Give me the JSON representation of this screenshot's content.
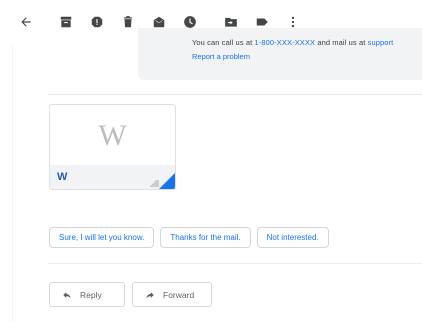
{
  "toolbar": {
    "icons": [
      "back-arrow-icon",
      "archive-icon",
      "report-spam-icon",
      "delete-icon",
      "mark-unread-icon",
      "snooze-icon",
      "move-to-icon",
      "label-icon",
      "more-vert-icon"
    ]
  },
  "info": {
    "line_start": "You can call us at",
    "phone_link": "1-800-XXX-XXXX",
    "line_middle": "and mail us at",
    "email_link": "support",
    "report_link": "Report a problem"
  },
  "attachment": {
    "preview_letter": "W",
    "type_letter": "W"
  },
  "smart_replies": [
    "Sure, I will let you know.",
    "Thanks for the mail.",
    "Not interested."
  ],
  "actions": {
    "reply_label": "Reply",
    "forward_label": "Forward"
  },
  "colors": {
    "link": "#1a73e8",
    "info_bg": "#f1f3f4",
    "word_blue": "#2a5aab"
  }
}
